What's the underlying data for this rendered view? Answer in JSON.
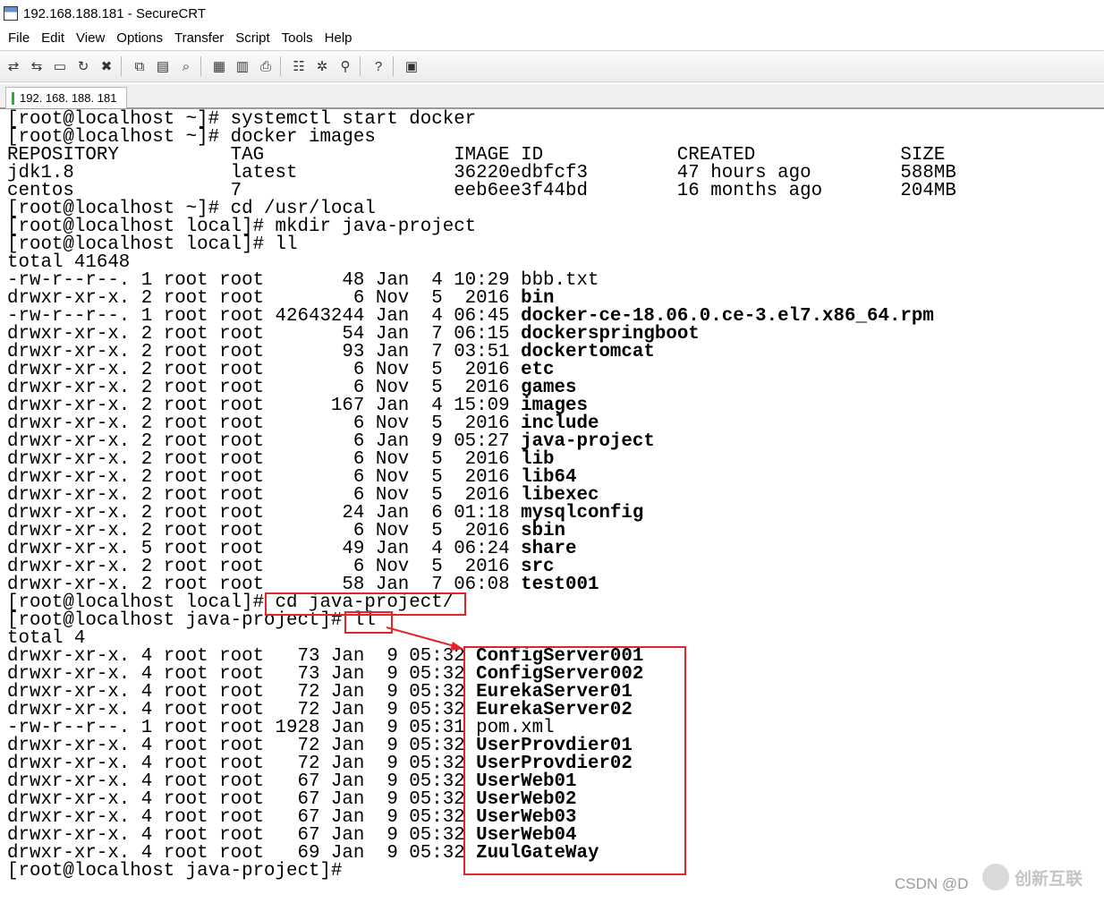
{
  "window": {
    "title": "192.168.188.181 - SecureCRT"
  },
  "menu": [
    "File",
    "Edit",
    "View",
    "Options",
    "Transfer",
    "Script",
    "Tools",
    "Help"
  ],
  "toolbar": {
    "buttons": [
      {
        "name": "connect-icon",
        "glyph": "⇄"
      },
      {
        "name": "quick-connect-icon",
        "glyph": "⇆"
      },
      {
        "name": "connect-in-tab-icon",
        "glyph": "▭"
      },
      {
        "name": "reconnect-icon",
        "glyph": "↻"
      },
      {
        "name": "disconnect-icon",
        "glyph": "✖"
      },
      {
        "sep": true
      },
      {
        "name": "copy-icon",
        "glyph": "⧉"
      },
      {
        "name": "paste-icon",
        "glyph": "▤"
      },
      {
        "name": "find-icon",
        "glyph": "⌕"
      },
      {
        "sep": true
      },
      {
        "name": "print-setup-icon",
        "glyph": "▦"
      },
      {
        "name": "print-selection-icon",
        "glyph": "▥"
      },
      {
        "name": "print-icon",
        "glyph": "⎙"
      },
      {
        "sep": true
      },
      {
        "name": "session-options-icon",
        "glyph": "☷"
      },
      {
        "name": "global-options-icon",
        "glyph": "✲"
      },
      {
        "name": "keymap-icon",
        "glyph": "⚲"
      },
      {
        "sep": true
      },
      {
        "name": "help-icon",
        "glyph": "?"
      },
      {
        "sep": true
      },
      {
        "name": "sftp-icon",
        "glyph": "▣"
      }
    ]
  },
  "tab": {
    "label": "192. 168. 188. 181"
  },
  "terminal": {
    "lines": [
      {
        "text": "[root@localhost ~]# systemctl start docker"
      },
      {
        "text": "[root@localhost ~]# docker images"
      },
      {
        "text": "REPOSITORY          TAG                 IMAGE ID            CREATED             SIZE"
      },
      {
        "text": "jdk1.8              latest              36220edbfcf3        47 hours ago        588MB"
      },
      {
        "text": "centos              7                   eeb6ee3f44bd        16 months ago       204MB"
      },
      {
        "text": "[root@localhost ~]# cd /usr/local"
      },
      {
        "text": "[root@localhost local]# mkdir java-project"
      },
      {
        "text": "[root@localhost local]# ll"
      },
      {
        "text": "total 41648"
      },
      {
        "text": "-rw-r--r--. 1 root root       48 Jan  4 10:29 bbb.txt"
      },
      {
        "text": "drwxr-xr-x. 2 root root        6 Nov  5  2016 ",
        "name": "bin",
        "bold": true
      },
      {
        "text": "-rw-r--r--. 1 root root 42643244 Jan  4 06:45 ",
        "name": "docker-ce-18.06.0.ce-3.el7.x86_64.rpm",
        "bold": true
      },
      {
        "text": "drwxr-xr-x. 2 root root       54 Jan  7 06:15 ",
        "name": "dockerspringboot",
        "bold": true
      },
      {
        "text": "drwxr-xr-x. 2 root root       93 Jan  7 03:51 ",
        "name": "dockertomcat",
        "bold": true
      },
      {
        "text": "drwxr-xr-x. 2 root root        6 Nov  5  2016 ",
        "name": "etc",
        "bold": true
      },
      {
        "text": "drwxr-xr-x. 2 root root        6 Nov  5  2016 ",
        "name": "games",
        "bold": true
      },
      {
        "text": "drwxr-xr-x. 2 root root      167 Jan  4 15:09 ",
        "name": "images",
        "bold": true
      },
      {
        "text": "drwxr-xr-x. 2 root root        6 Nov  5  2016 ",
        "name": "include",
        "bold": true
      },
      {
        "text": "drwxr-xr-x. 2 root root        6 Jan  9 05:27 ",
        "name": "java-project",
        "bold": true
      },
      {
        "text": "drwxr-xr-x. 2 root root        6 Nov  5  2016 ",
        "name": "lib",
        "bold": true
      },
      {
        "text": "drwxr-xr-x. 2 root root        6 Nov  5  2016 ",
        "name": "lib64",
        "bold": true
      },
      {
        "text": "drwxr-xr-x. 2 root root        6 Nov  5  2016 ",
        "name": "libexec",
        "bold": true
      },
      {
        "text": "drwxr-xr-x. 2 root root       24 Jan  6 01:18 ",
        "name": "mysqlconfig",
        "bold": true
      },
      {
        "text": "drwxr-xr-x. 2 root root        6 Nov  5  2016 ",
        "name": "sbin",
        "bold": true
      },
      {
        "text": "drwxr-xr-x. 5 root root       49 Jan  4 06:24 ",
        "name": "share",
        "bold": true
      },
      {
        "text": "drwxr-xr-x. 2 root root        6 Nov  5  2016 ",
        "name": "src",
        "bold": true
      },
      {
        "text": "drwxr-xr-x. 2 root root       58 Jan  7 06:08 ",
        "name": "test001",
        "bold": true
      },
      {
        "text": "[root@localhost local]# cd java-project/"
      },
      {
        "text": "[root@localhost java-project]# ll"
      },
      {
        "text": "total 4"
      },
      {
        "text": "drwxr-xr-x. 4 root root   73 Jan  9 05:32 ",
        "name": "ConfigServer001",
        "bold": true
      },
      {
        "text": "drwxr-xr-x. 4 root root   73 Jan  9 05:32 ",
        "name": "ConfigServer002",
        "bold": true
      },
      {
        "text": "drwxr-xr-x. 4 root root   72 Jan  9 05:32 ",
        "name": "EurekaServer01",
        "bold": true
      },
      {
        "text": "drwxr-xr-x. 4 root root   72 Jan  9 05:32 ",
        "name": "EurekaServer02",
        "bold": true
      },
      {
        "text": "-rw-r--r--. 1 root root 1928 Jan  9 05:31 ",
        "name": "pom.xml",
        "bold": false
      },
      {
        "text": "drwxr-xr-x. 4 root root   72 Jan  9 05:32 ",
        "name": "UserProvdier01",
        "bold": true
      },
      {
        "text": "drwxr-xr-x. 4 root root   72 Jan  9 05:32 ",
        "name": "UserProvdier02",
        "bold": true
      },
      {
        "text": "drwxr-xr-x. 4 root root   67 Jan  9 05:32 ",
        "name": "UserWeb01",
        "bold": true
      },
      {
        "text": "drwxr-xr-x. 4 root root   67 Jan  9 05:32 ",
        "name": "UserWeb02",
        "bold": true
      },
      {
        "text": "drwxr-xr-x. 4 root root   67 Jan  9 05:32 ",
        "name": "UserWeb03",
        "bold": true
      },
      {
        "text": "drwxr-xr-x. 4 root root   67 Jan  9 05:32 ",
        "name": "UserWeb04",
        "bold": true
      },
      {
        "text": "drwxr-xr-x. 4 root root   69 Jan  9 05:32 ",
        "name": "ZuulGateWay",
        "bold": true
      },
      {
        "text": "[root@localhost java-project]# "
      }
    ]
  },
  "annotation": {
    "color": "#e0262b"
  },
  "watermark": {
    "csdn": "CSDN @D",
    "brand": "创新互联"
  }
}
